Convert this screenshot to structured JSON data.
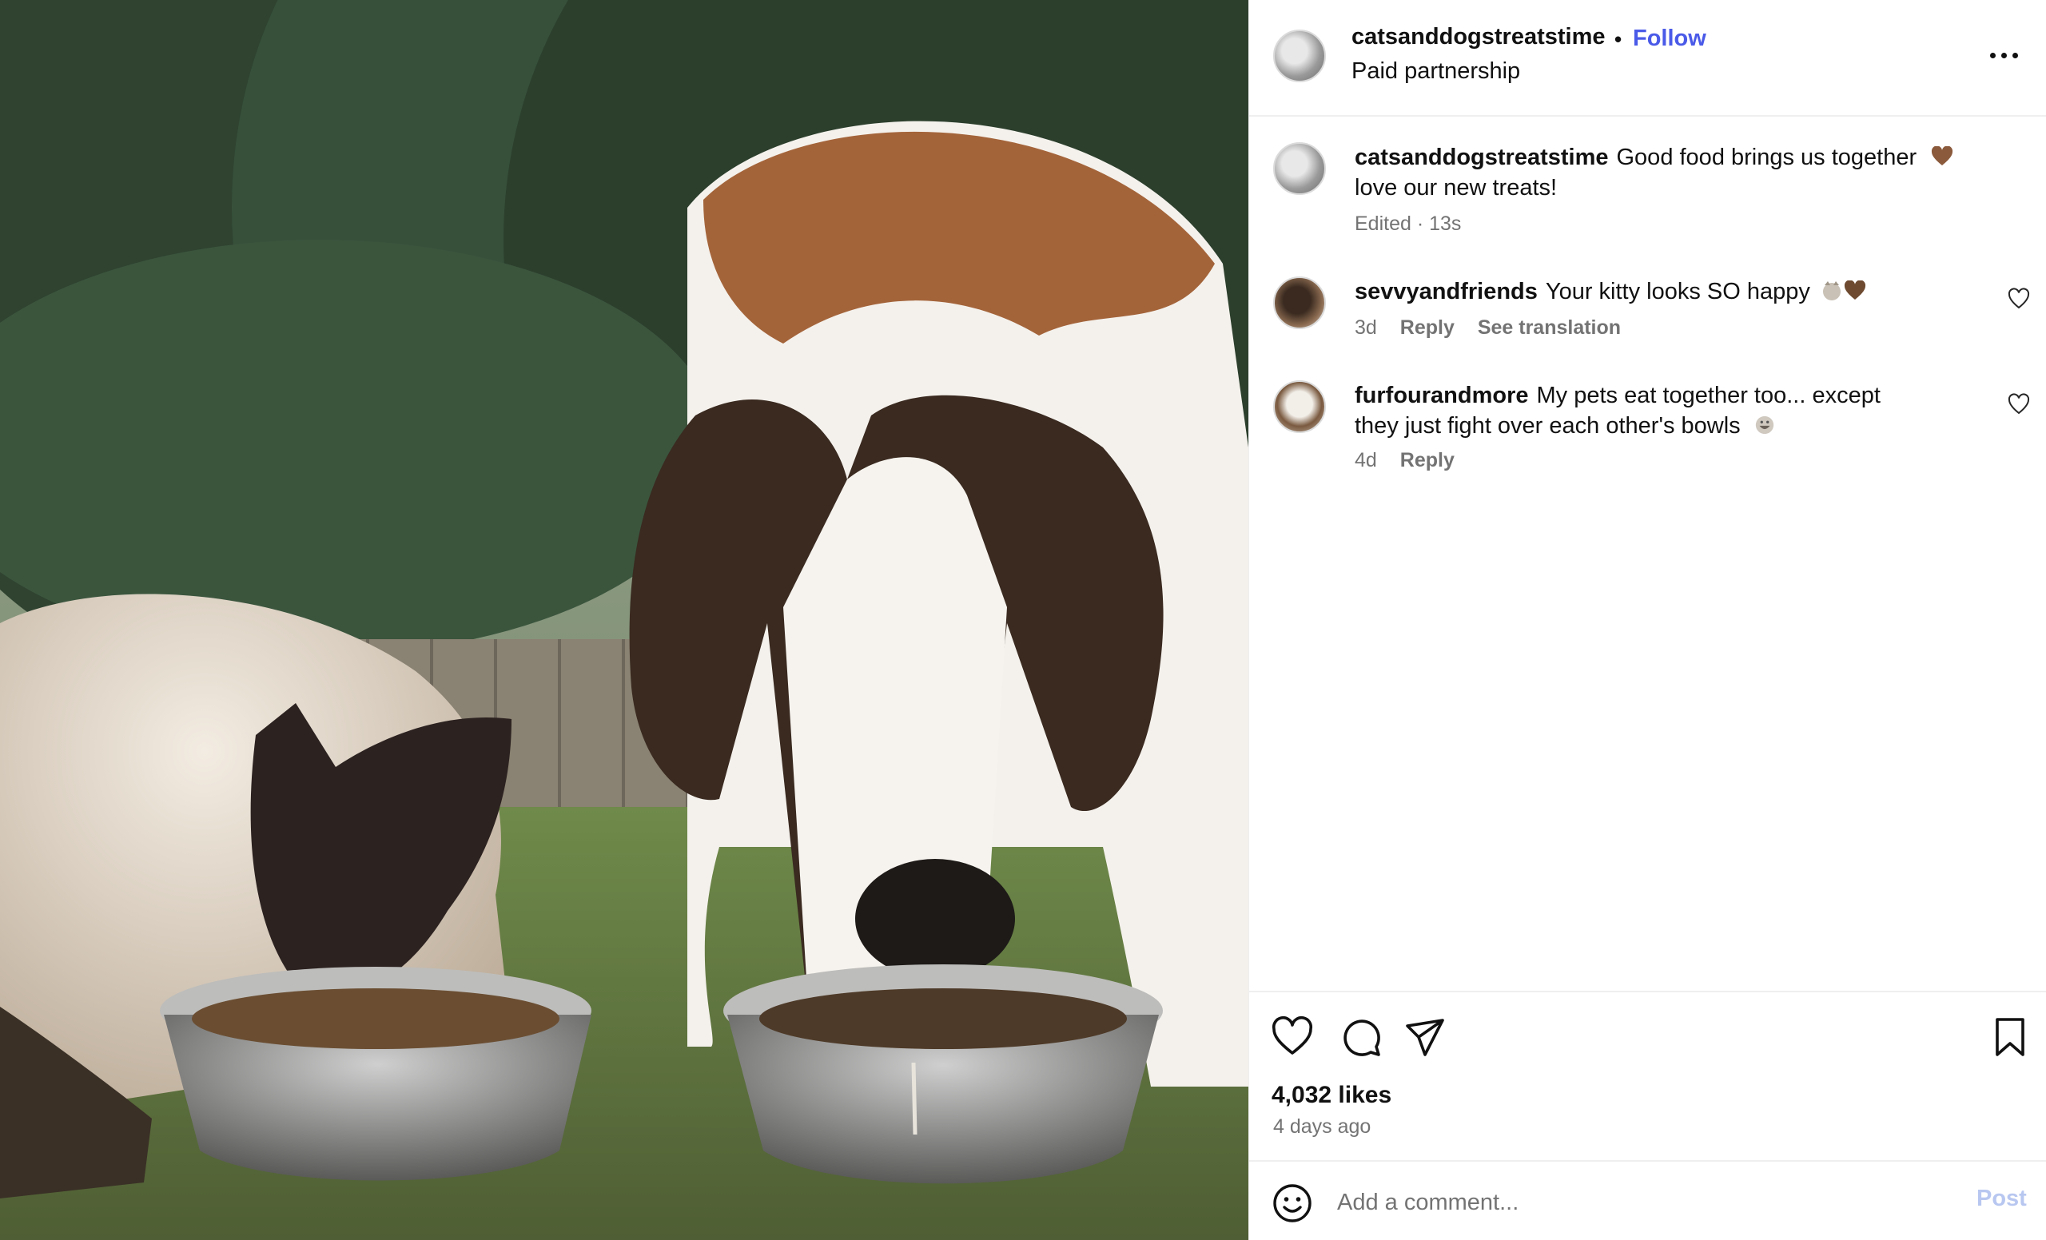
{
  "post": {
    "username": "catsanddogstreatstime",
    "separator": "•",
    "follow_label": "Follow",
    "subtitle": "Paid partnership",
    "more_icon": "more-horizontal-icon"
  },
  "caption": {
    "username": "catsanddogstreatstime",
    "text_line1": "Good food brings us together",
    "text_line2": "love our new treats!",
    "emoji": "brown-heart-emoji",
    "meta": "Edited · 13s"
  },
  "comments": [
    {
      "username": "sevvyandfriends",
      "text": "Your kitty looks SO happy",
      "emoji": "cat-and-brown-heart-emoji",
      "time": "3d",
      "reply_label": "Reply",
      "translation_label": "See translation"
    },
    {
      "username": "furfourandmore",
      "text_line1": "My pets eat together too... except",
      "text_line2": "they just fight over each other's bowls",
      "emoji": "grinning-face-emoji",
      "time": "4d",
      "reply_label": "Reply"
    }
  ],
  "actions": {
    "icons": [
      "heart-icon",
      "comment-icon",
      "share-icon",
      "bookmark-icon"
    ],
    "likes": "4,032 likes",
    "posted": "4 days ago"
  },
  "composer": {
    "placeholder": "Add a comment...",
    "post_label": "Post",
    "emoji_icon": "smiley-icon"
  },
  "colors": {
    "link": "#4a5ae8",
    "muted": "#737373",
    "post_disabled": "#b8c7f0",
    "divider": "#efefef"
  }
}
